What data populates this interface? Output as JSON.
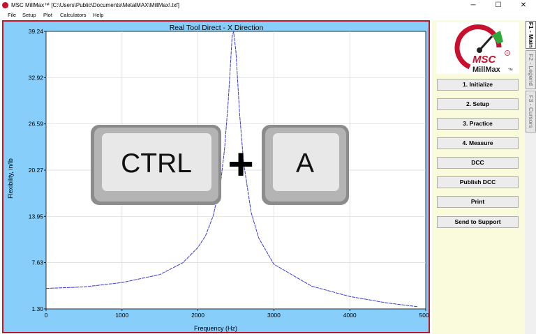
{
  "window": {
    "title": "MSC MillMax™ [C:\\Users\\Public\\Documents\\MetalMAX\\MillMax\\.txf]",
    "minimize_glyph": "─",
    "maximize_glyph": "☐",
    "close_glyph": "✕"
  },
  "menu": {
    "items": [
      "File",
      "Setup",
      "Plot",
      "Calculators",
      "Help"
    ]
  },
  "chart_data": {
    "type": "line",
    "title": "Real Tool Direct - X Direction",
    "xlabel": "Frequency (Hz)",
    "ylabel": "Flexibility, in/lb",
    "xlim": [
      0,
      5000
    ],
    "ylim": [
      1.3,
      39.24
    ],
    "xticks": [
      0,
      1000,
      2000,
      3000,
      4000,
      5000
    ],
    "yticks": [
      "1.30",
      "7.63",
      "13.95",
      "20.27",
      "26.59",
      "32.92",
      "39.24"
    ],
    "grid": true,
    "line_color": "#3838d8",
    "series": [
      {
        "x": [
          0,
          500,
          1000,
          1500,
          1800,
          2000,
          2100,
          2200,
          2300,
          2350,
          2400,
          2430,
          2450,
          2470,
          2500,
          2550,
          2600,
          2700,
          2800,
          3000,
          3500,
          4000,
          4500,
          4900
        ],
        "y": [
          4.1,
          4.3,
          4.9,
          6.0,
          7.6,
          9.7,
          11.3,
          14.0,
          18.6,
          23.1,
          29.8,
          35.0,
          38.6,
          39.2,
          36.5,
          27.9,
          21.4,
          14.5,
          11.0,
          7.4,
          4.4,
          3.0,
          2.1,
          1.6
        ]
      }
    ]
  },
  "overlay": {
    "ctrl_label": "CTRL",
    "plus_label": "+",
    "a_label": "A"
  },
  "sidebar": {
    "logo_text": "MSC",
    "logo_subtext": "MillMax",
    "logo_mark": "®",
    "logo_tm": "TM",
    "buttons": [
      "1. Initialize",
      "2. Setup",
      "3. Practice",
      "4. Measure",
      "DCC",
      "Publish DCC",
      "Print",
      "Send to Support"
    ]
  },
  "tabs": [
    "F1 - Main",
    "F2 - Legend",
    "F3 - Cursors"
  ],
  "colors": {
    "plot_bg": "#87cefa",
    "frame": "#b01c2e",
    "sidebar_bg": "#fafadc"
  }
}
